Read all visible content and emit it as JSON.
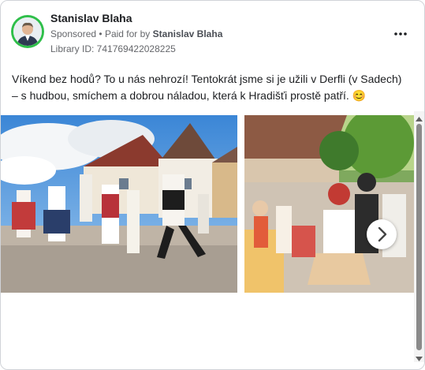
{
  "post": {
    "author": "Stanislav Blaha",
    "sponsored_label": "Sponsored",
    "paid_for_prefix": "Paid for by",
    "paid_for_name": "Stanislav Blaha",
    "library_id": "Library ID: 741769422028225",
    "body_text": "Víkend bez hodů? To u nás nehrozí! Tentokrát jsme si je užili v Derfli (v Sadech) – s hudbou, smíchem a dobrou náladou, která k Hradišťi prostě patří. 😊"
  },
  "icons": {
    "more": "more-options-icon",
    "next": "chevron-right-icon",
    "scroll_up": "scroll-up-arrow-icon",
    "scroll_down": "scroll-down-arrow-icon"
  },
  "colors": {
    "avatar_ring": "#2fbf4a",
    "text_primary": "#1c1e21",
    "text_secondary": "#65676b"
  }
}
